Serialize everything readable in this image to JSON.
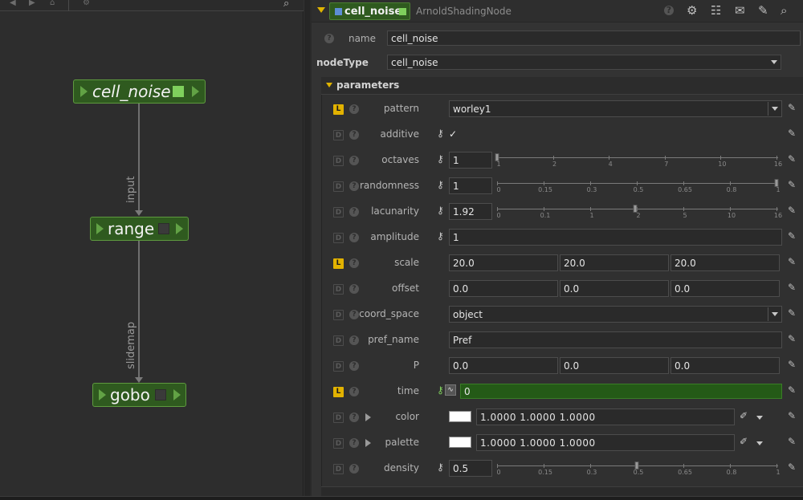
{
  "graph": {
    "nodes": [
      {
        "name": "cell_noise",
        "status_color": "#7fd05c"
      },
      {
        "name": "range",
        "status_color": "#3d3d3d"
      },
      {
        "name": "gobo",
        "status_color": "#3d3d3d"
      }
    ],
    "wires": [
      {
        "label": "input"
      },
      {
        "label": "slidemap"
      }
    ]
  },
  "header": {
    "node_name": "cell_noise",
    "node_type": "ArnoldShadingNode",
    "icons": [
      "help-icon",
      "gear-icon",
      "layout-icon",
      "comment-icon",
      "wrench-icon",
      "search-icon"
    ]
  },
  "fields": {
    "name_label": "name",
    "name_value": "cell_noise",
    "nodetype_label": "nodeType",
    "nodetype_value": "cell_noise"
  },
  "parameters": {
    "title": "parameters",
    "rows": [
      {
        "badge": "L",
        "label": "pattern",
        "kind": "dropdown",
        "value": "worley1"
      },
      {
        "badge": "D",
        "label": "additive",
        "kind": "checkbox",
        "value": "✓"
      },
      {
        "badge": "D",
        "label": "octaves",
        "kind": "slider",
        "value": "1",
        "ticks": [
          "1",
          "2",
          "4",
          "7",
          "10",
          "16"
        ],
        "level": 0.0
      },
      {
        "badge": "D",
        "label": "randomness",
        "kind": "slider",
        "value": "1",
        "ticks": [
          "0",
          "0.15",
          "0.3",
          "0.5",
          "0.65",
          "0.8",
          "1"
        ],
        "level": 1.0
      },
      {
        "badge": "D",
        "label": "lacunarity",
        "kind": "slider",
        "value": "1.92",
        "ticks": [
          "0",
          "0.1",
          "1",
          "2",
          "5",
          "10",
          "16"
        ],
        "level": 0.495
      },
      {
        "badge": "D",
        "label": "amplitude",
        "kind": "number",
        "value": "1"
      },
      {
        "badge": "L",
        "label": "scale",
        "kind": "vec3",
        "values": [
          "20.0",
          "20.0",
          "20.0"
        ]
      },
      {
        "badge": "D",
        "label": "offset",
        "kind": "vec3",
        "values": [
          "0.0",
          "0.0",
          "0.0"
        ]
      },
      {
        "badge": "D",
        "label": "coord_space",
        "kind": "dropdown",
        "value": "object"
      },
      {
        "badge": "D",
        "label": "pref_name",
        "kind": "text",
        "value": "Pref"
      },
      {
        "badge": "D",
        "label": "P",
        "kind": "vec3",
        "values": [
          "0.0",
          "0.0",
          "0.0"
        ]
      },
      {
        "badge": "L",
        "label": "time",
        "kind": "animated",
        "value": "0"
      },
      {
        "badge": "D",
        "label": "color",
        "kind": "color",
        "value": "1.0000  1.0000  1.0000",
        "swatch": "#ffffff"
      },
      {
        "badge": "D",
        "label": "palette",
        "kind": "color",
        "value": "1.0000  1.0000  1.0000",
        "swatch": "#ffffff"
      },
      {
        "badge": "D",
        "label": "density",
        "kind": "slider",
        "value": "0.5",
        "ticks": [
          "0",
          "0.15",
          "0.3",
          "0.5",
          "0.65",
          "0.8",
          "1"
        ],
        "level": 0.5
      }
    ]
  },
  "colors": {
    "accent_yellow": "#e2b200",
    "node_green": "#2f5a1f",
    "animated_green": "#245a17"
  }
}
